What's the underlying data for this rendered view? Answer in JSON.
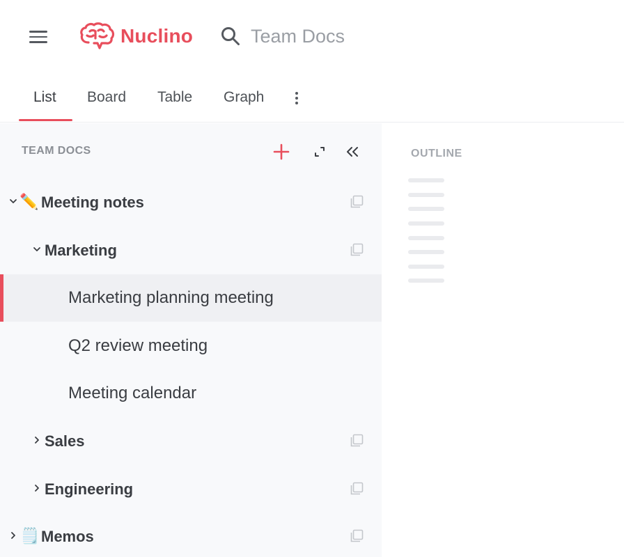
{
  "header": {
    "app_name": "Nuclino",
    "search_text": "Team Docs",
    "brand_color": "#e84e5c"
  },
  "tabs": [
    {
      "label": "List",
      "active": true
    },
    {
      "label": "Board",
      "active": false
    },
    {
      "label": "Table",
      "active": false
    },
    {
      "label": "Graph",
      "active": false
    }
  ],
  "sidebar": {
    "title": "TEAM DOCS",
    "items": [
      {
        "label": "Meeting notes",
        "emoji": "✏️",
        "expanded": true
      },
      {
        "label": "Marketing",
        "expanded": true
      },
      {
        "label": "Marketing planning meeting",
        "selected": true
      },
      {
        "label": "Q2 review meeting"
      },
      {
        "label": "Meeting calendar"
      },
      {
        "label": "Sales",
        "expanded": false
      },
      {
        "label": "Engineering",
        "expanded": false
      },
      {
        "label": "Memos",
        "emoji": "🗒️",
        "expanded": false
      }
    ]
  },
  "outline": {
    "title": "OUTLINE"
  }
}
